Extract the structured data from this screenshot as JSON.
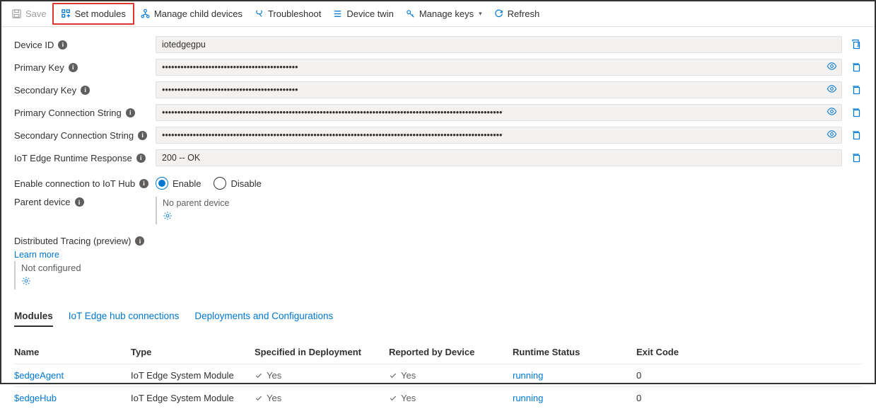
{
  "toolbar": {
    "save": "Save",
    "set_modules": "Set modules",
    "manage_children": "Manage child devices",
    "troubleshoot": "Troubleshoot",
    "device_twin": "Device twin",
    "manage_keys": "Manage keys",
    "refresh": "Refresh"
  },
  "form": {
    "device_id": {
      "label": "Device ID",
      "value": "iotedgegpu"
    },
    "primary_key": {
      "label": "Primary Key",
      "value": "••••••••••••••••••••••••••••••••••••••••••••"
    },
    "secondary_key": {
      "label": "Secondary Key",
      "value": "••••••••••••••••••••••••••••••••••••••••••••"
    },
    "primary_conn": {
      "label": "Primary Connection String",
      "value": "••••••••••••••••••••••••••••••••••••••••••••••••••••••••••••••••••••••••••••••••••••••••••••••••••••••••••••••"
    },
    "secondary_conn": {
      "label": "Secondary Connection String",
      "value": "••••••••••••••••••••••••••••••••••••••••••••••••••••••••••••••••••••••••••••••••••••••••••••••••••••••••••••••"
    },
    "runtime_resp": {
      "label": "IoT Edge Runtime Response",
      "value": "200 -- OK"
    },
    "enable_conn": {
      "label": "Enable connection to IoT Hub",
      "enable": "Enable",
      "disable": "Disable"
    },
    "parent_device": {
      "label": "Parent device",
      "none": "No parent device"
    },
    "tracing": {
      "label": "Distributed Tracing (preview)",
      "learn": "Learn more",
      "not_configured": "Not configured"
    }
  },
  "tabs": {
    "modules": "Modules",
    "connections": "IoT Edge hub connections",
    "deployments": "Deployments and Configurations"
  },
  "modules_table": {
    "headers": {
      "name": "Name",
      "type": "Type",
      "specified": "Specified in Deployment",
      "reported": "Reported by Device",
      "runtime": "Runtime Status",
      "exit": "Exit Code"
    },
    "rows": [
      {
        "name": "$edgeAgent",
        "type": "IoT Edge System Module",
        "specified": "Yes",
        "reported": "Yes",
        "runtime": "running",
        "exit": "0"
      },
      {
        "name": "$edgeHub",
        "type": "IoT Edge System Module",
        "specified": "Yes",
        "reported": "Yes",
        "runtime": "running",
        "exit": "0"
      }
    ]
  }
}
